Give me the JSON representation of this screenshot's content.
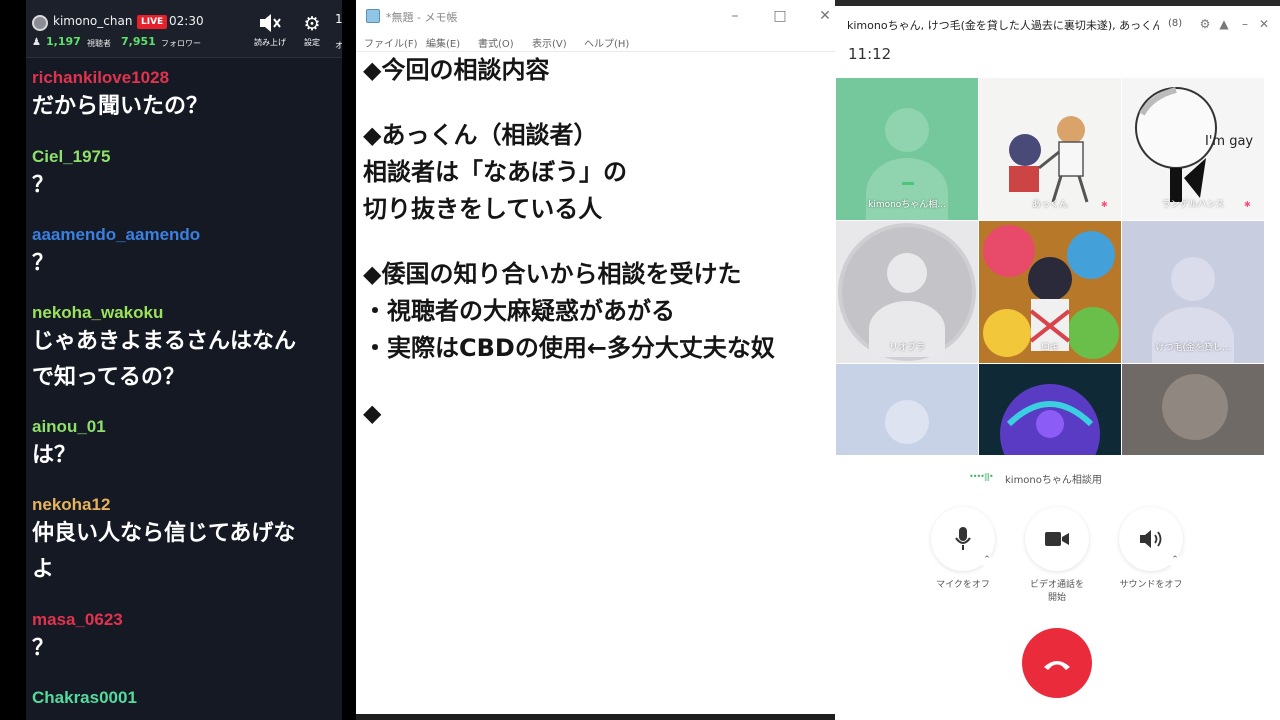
{
  "stream": {
    "channel_name": "kimono_chan",
    "live_label": "LIVE",
    "elapsed": "02:30",
    "viewers": "1,197",
    "viewers_label": "視聴者",
    "followers": "7,951",
    "followers_label": "フォロワー",
    "tools": {
      "read_aloud_label": "読み上げ",
      "settings_label": "設定",
      "cut_top": "1",
      "cut_bottom": "オ"
    }
  },
  "chat": {
    "messages": [
      {
        "user": "richankilove1028",
        "color": "#e0334f",
        "text_lines": [
          "だから聞いたの？"
        ]
      },
      {
        "user": "Ciel_1975",
        "color": "#8ee06b",
        "text_lines": [
          "？"
        ]
      },
      {
        "user": "aaamendo_aamendo",
        "color": "#3b7fe0",
        "text_lines": [
          "？"
        ]
      },
      {
        "user": "nekoha_wakoku",
        "color": "#9be25c",
        "text_lines": [
          "じゃあきよまるさんはなん",
          "で知ってるの？"
        ]
      },
      {
        "user": "ainou_01",
        "color": "#8ee06b",
        "text_lines": [
          "は？"
        ]
      },
      {
        "user": "nekoha12",
        "color": "#e6b25c",
        "text_lines": [
          "仲良い人なら信じてあげな",
          "よ"
        ]
      },
      {
        "user": "masa_0623",
        "color": "#e0334f",
        "text_lines": [
          "？"
        ]
      },
      {
        "user": "Chakras0001",
        "color": "#56d99c",
        "text_lines": []
      }
    ]
  },
  "notepad": {
    "title": "*無題 - メモ帳",
    "menus": [
      "ファイル(F)",
      "編集(E)",
      "書式(O)",
      "表示(V)",
      "ヘルプ(H)"
    ],
    "lines": [
      "◆今回の相談内容",
      "",
      "◆あっくん（相談者）",
      "相談者は「なあぼう」の",
      "切り抜きをしている人",
      "",
      "◆倭国の知り合いから相談を受けた",
      "・視聴者の大麻疑惑があがる",
      "・実際はCBDの使用←多分大丈夫な奴",
      "",
      "◆"
    ]
  },
  "call": {
    "title": "kimonoちゃん, けつ毛(金を貸した人過去に裏切未遂), あっくん...",
    "participant_count": "(8)",
    "timer": "11:12",
    "participants": [
      {
        "name": "kimonoちゃん相...",
        "kind": "default-green",
        "muted": false
      },
      {
        "name": "あっくん",
        "kind": "illustration-anime",
        "muted": true
      },
      {
        "name": "ランゲルハンス",
        "kind": "illustration-lamp",
        "muted": true,
        "caption": "I'm gay"
      },
      {
        "name": "リオブラ",
        "kind": "default-gray-circle",
        "muted": false
      },
      {
        "name": "ロキ",
        "kind": "illustration-colorful",
        "muted": false
      },
      {
        "name": "けつ毛(金を貸し...",
        "kind": "default-lavender",
        "muted": false
      },
      {
        "name": "",
        "kind": "default-light",
        "muted": false
      },
      {
        "name": "",
        "kind": "illustration-blue",
        "muted": false
      },
      {
        "name": "",
        "kind": "photo-plush",
        "muted": false
      }
    ],
    "speaking_room": "kimonoちゃん相談用",
    "controls": [
      {
        "label_lines": [
          "マイクをオフ"
        ],
        "icon": "microphone-icon"
      },
      {
        "label_lines": [
          "ビデオ通話を",
          "開始"
        ],
        "icon": "video-camera-icon"
      },
      {
        "label_lines": [
          "サウンドをオフ"
        ],
        "icon": "speaker-icon"
      }
    ],
    "hangup_icon": "phone-hangup-icon",
    "colors": {
      "hangup": "#ea2b3c",
      "speaking": "#43b66b"
    }
  }
}
